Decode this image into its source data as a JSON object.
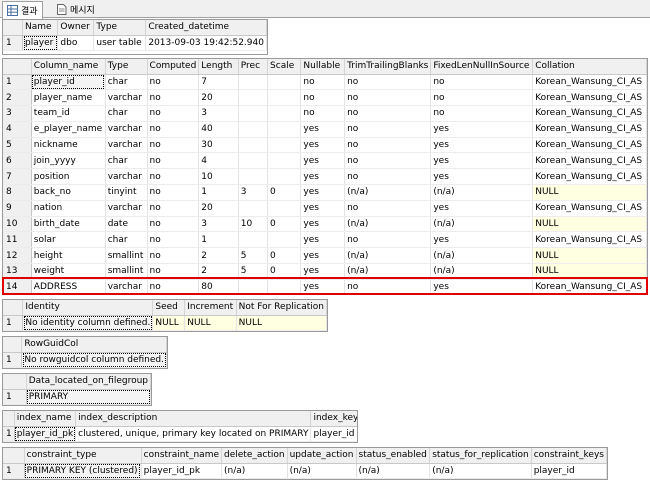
{
  "tabs": [
    {
      "label": "결과",
      "active": true,
      "icon": "grid-icon"
    },
    {
      "label": "메시지",
      "active": false,
      "icon": "message-icon"
    }
  ],
  "grid1": {
    "columns": [
      "Name",
      "Owner",
      "Type",
      "Created_datetime"
    ],
    "rows": [
      [
        "1",
        "player",
        "dbo",
        "user table",
        "2013-09-03 19:42:52.940"
      ]
    ]
  },
  "grid2": {
    "columns": [
      "Column_name",
      "Type",
      "Computed",
      "Length",
      "Prec",
      "Scale",
      "Nullable",
      "TrimTrailingBlanks",
      "FixedLenNullInSource",
      "Collation"
    ],
    "rows": [
      [
        "1",
        "player_id",
        "char",
        "no",
        "7",
        "",
        "",
        "no",
        "no",
        "no",
        "Korean_Wansung_CI_AS"
      ],
      [
        "2",
        "player_name",
        "varchar",
        "no",
        "20",
        "",
        "",
        "no",
        "no",
        "no",
        "Korean_Wansung_CI_AS"
      ],
      [
        "3",
        "team_id",
        "char",
        "no",
        "3",
        "",
        "",
        "no",
        "no",
        "no",
        "Korean_Wansung_CI_AS"
      ],
      [
        "4",
        "e_player_name",
        "varchar",
        "no",
        "40",
        "",
        "",
        "yes",
        "no",
        "yes",
        "Korean_Wansung_CI_AS"
      ],
      [
        "5",
        "nickname",
        "varchar",
        "no",
        "30",
        "",
        "",
        "yes",
        "no",
        "yes",
        "Korean_Wansung_CI_AS"
      ],
      [
        "6",
        "join_yyyy",
        "char",
        "no",
        "4",
        "",
        "",
        "yes",
        "no",
        "yes",
        "Korean_Wansung_CI_AS"
      ],
      [
        "7",
        "position",
        "varchar",
        "no",
        "10",
        "",
        "",
        "yes",
        "no",
        "yes",
        "Korean_Wansung_CI_AS"
      ],
      [
        "8",
        "back_no",
        "tinyint",
        "no",
        "1",
        "3",
        "0",
        "yes",
        "(n/a)",
        "(n/a)",
        "NULL"
      ],
      [
        "9",
        "nation",
        "varchar",
        "no",
        "20",
        "",
        "",
        "yes",
        "no",
        "yes",
        "Korean_Wansung_CI_AS"
      ],
      [
        "10",
        "birth_date",
        "date",
        "no",
        "3",
        "10",
        "0",
        "yes",
        "(n/a)",
        "(n/a)",
        "NULL"
      ],
      [
        "11",
        "solar",
        "char",
        "no",
        "1",
        "",
        "",
        "yes",
        "no",
        "yes",
        "Korean_Wansung_CI_AS"
      ],
      [
        "12",
        "height",
        "smallint",
        "no",
        "2",
        "5",
        "0",
        "yes",
        "(n/a)",
        "(n/a)",
        "NULL"
      ],
      [
        "13",
        "weight",
        "smallint",
        "no",
        "2",
        "5",
        "0",
        "yes",
        "(n/a)",
        "(n/a)",
        "NULL"
      ],
      [
        "14",
        "ADDRESS",
        "varchar",
        "no",
        "80",
        "",
        "",
        "yes",
        "no",
        "yes",
        "Korean_Wansung_CI_AS"
      ]
    ]
  },
  "grid3": {
    "columns": [
      "Identity",
      "Seed",
      "Increment",
      "Not For Replication"
    ],
    "rows": [
      [
        "1",
        "No identity column defined.",
        "NULL",
        "NULL",
        "NULL"
      ]
    ]
  },
  "grid4": {
    "columns": [
      "RowGuidCol"
    ],
    "rows": [
      [
        "1",
        "No rowguidcol column defined."
      ]
    ]
  },
  "grid5": {
    "columns": [
      "Data_located_on_filegroup"
    ],
    "rows": [
      [
        "1",
        "PRIMARY"
      ]
    ]
  },
  "grid6": {
    "columns": [
      "index_name",
      "index_description",
      "index_keys"
    ],
    "rows": [
      [
        "1",
        "player_id_pk",
        "clustered, unique, primary key located on PRIMARY",
        "player_id"
      ]
    ]
  },
  "grid7": {
    "columns": [
      "constraint_type",
      "constraint_name",
      "delete_action",
      "update_action",
      "status_enabled",
      "status_for_replication",
      "constraint_keys"
    ],
    "rows": [
      [
        "1",
        "PRIMARY KEY (clustered)",
        "player_id_pk",
        "(n/a)",
        "(n/a)",
        "(n/a)",
        "(n/a)",
        "player_id"
      ]
    ]
  },
  "highlight_color": "#e00000",
  "null_cell_color": "#ffffe1"
}
